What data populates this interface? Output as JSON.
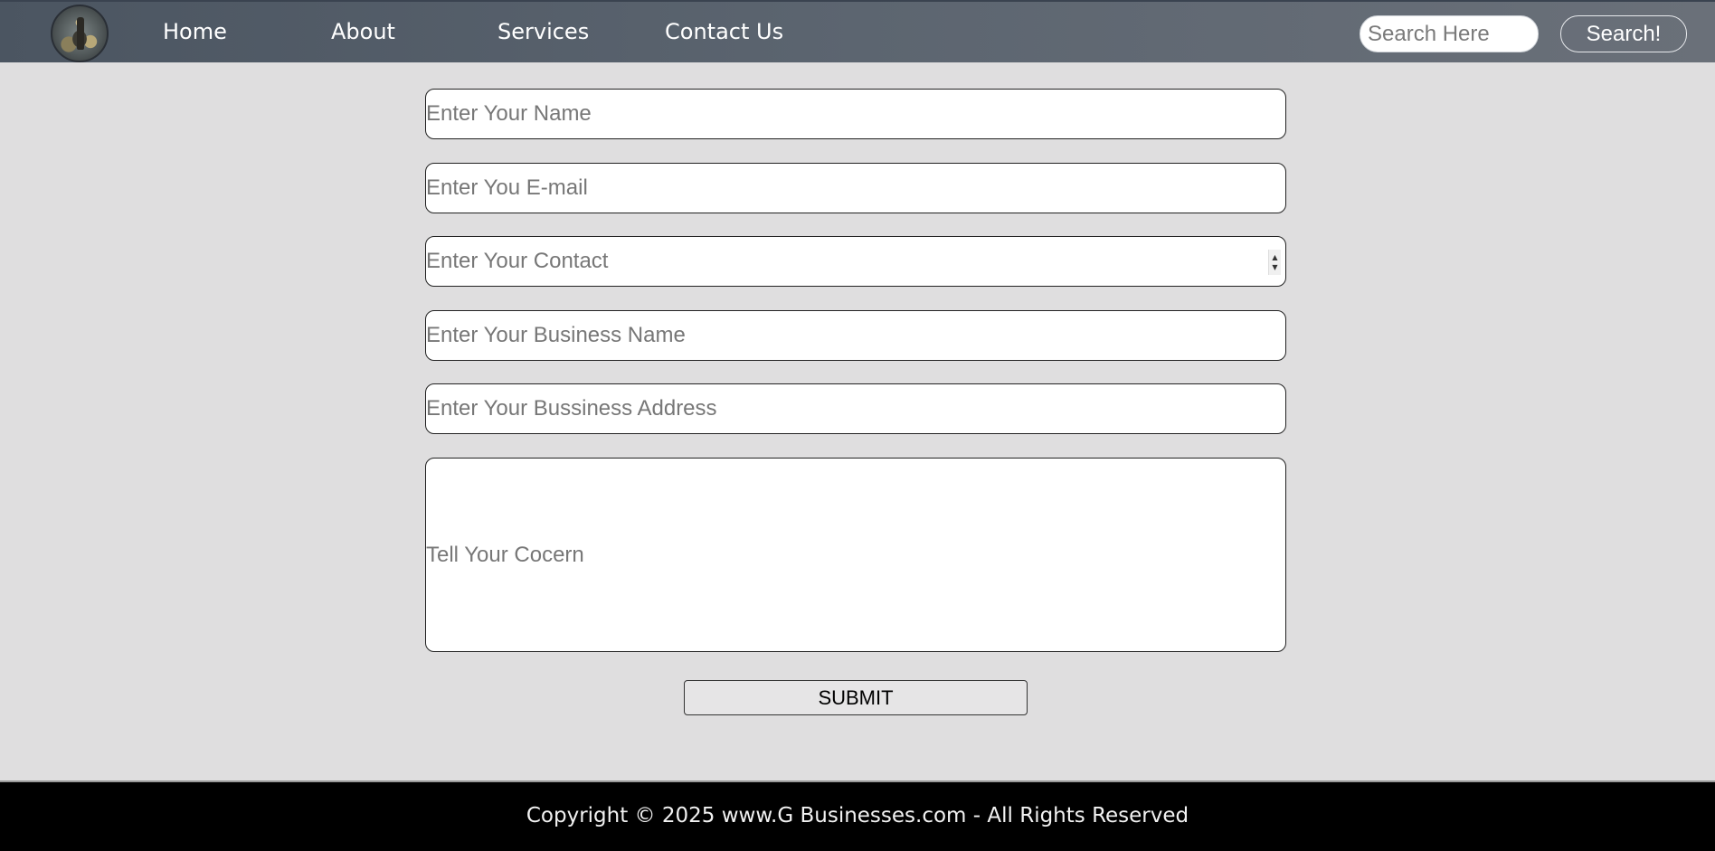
{
  "nav": {
    "logo_icon": "chess-piece-logo-icon",
    "links": [
      "Home",
      "About",
      "Services",
      "Contact Us"
    ],
    "search_placeholder": "Search Here",
    "search_button": "Search!",
    "colors": {
      "bar": "#5a636e",
      "text": "#ffffff"
    }
  },
  "form": {
    "name_placeholder": "Enter Your Name",
    "email_placeholder": "Enter You E-mail",
    "contact_placeholder": "Enter Your Contact",
    "business_name_placeholder": "Enter Your Business Name",
    "business_address_placeholder": "Enter Your Bussiness Address",
    "concern_placeholder": "Tell Your Cocern",
    "submit_label": "SUBMIT",
    "spinner_up": "▲",
    "spinner_down": "▼"
  },
  "footer": {
    "text": "Copyright © 2025 www.G Businesses.com - All Rights Reserved"
  },
  "colors": {
    "page_background": "#dfdedf",
    "footer_background": "#000000"
  }
}
